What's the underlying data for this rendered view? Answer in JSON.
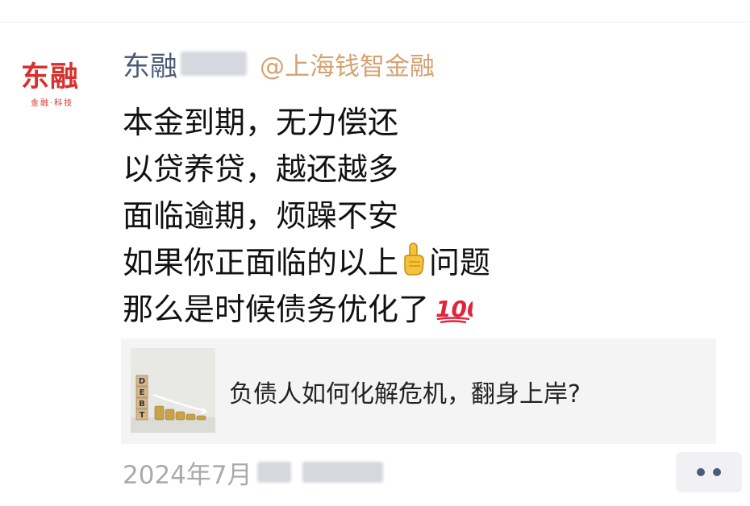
{
  "author": {
    "avatar_logo_text": "东融",
    "avatar_logo_subtext": "金融·科技",
    "name": "东融",
    "handle": "@上海钱智金融"
  },
  "post": {
    "lines": [
      "本金到期，无力偿还",
      "以贷养贷，越还越多",
      "面临逾期，烦躁不安",
      "如果你正面临的以上",
      "那么是时候债务优化了"
    ],
    "line4_suffix": "问题",
    "emoji_hand": "pointing-up-icon",
    "emoji_100": "hundred-points-icon"
  },
  "link_card": {
    "title": "负债人如何化解危机，翻身上岸?",
    "thumbnail_blocks": [
      "D",
      "E",
      "B",
      "T"
    ]
  },
  "footer": {
    "date_prefix": "2024年7月"
  },
  "colors": {
    "name": "#4a5a7a",
    "handle": "#d5a373",
    "logo": "#d9302d",
    "card_bg": "#f4f4f4"
  }
}
